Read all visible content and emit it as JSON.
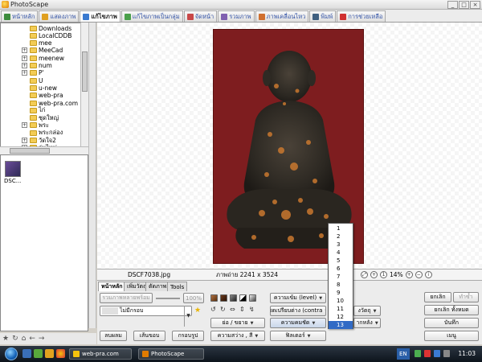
{
  "window": {
    "title": "PhotoScape",
    "min": "_",
    "max": "□",
    "close": "×"
  },
  "tabs": [
    {
      "label": "หน้าหลัก",
      "icon": "home-icon",
      "color": "#3d8c3d"
    },
    {
      "label": "แสดงภาพ",
      "icon": "viewer-icon",
      "color": "#e0a020"
    },
    {
      "label": "แก้ไขภาพ",
      "icon": "editor-icon",
      "color": "#3a7ad0"
    },
    {
      "label": "แก้ไขภาพเป็นกลุ่ม",
      "icon": "batch-icon",
      "color": "#4aa04a"
    },
    {
      "label": "จัดหน้า",
      "icon": "page-icon",
      "color": "#c84848"
    },
    {
      "label": "รวมภาพ",
      "icon": "combine-icon",
      "color": "#8060b0"
    },
    {
      "label": "ภาพเคลื่อนไหว",
      "icon": "gif-icon",
      "color": "#d07030"
    },
    {
      "label": "พิมพ์",
      "icon": "print-icon",
      "color": "#406080"
    },
    {
      "label": "การช่วยเหลือ",
      "icon": "help-icon",
      "color": "#d03030"
    }
  ],
  "tree": {
    "items": [
      {
        "label": "Downloads",
        "plus": false
      },
      {
        "label": "LocalCDDB",
        "plus": false
      },
      {
        "label": "mee",
        "plus": false
      },
      {
        "label": "MeeCad",
        "plus": true
      },
      {
        "label": "meenew",
        "plus": true
      },
      {
        "label": "num",
        "plus": true
      },
      {
        "label": "P'",
        "plus": true
      },
      {
        "label": "U",
        "plus": false
      },
      {
        "label": "u-new",
        "plus": false
      },
      {
        "label": "web-pra",
        "plus": false
      },
      {
        "label": "web-pra.com",
        "plus": false
      },
      {
        "label": "ไก่",
        "plus": false
      },
      {
        "label": "ชุดใหญ่",
        "plus": false
      },
      {
        "label": "พระ",
        "plus": true
      },
      {
        "label": "พระกล่อง",
        "plus": false
      },
      {
        "label": "วัดใจ2",
        "plus": true
      },
      {
        "label": "รุ่นไหม่",
        "plus": true
      }
    ]
  },
  "thumbnail": {
    "label": "DSC..."
  },
  "status": {
    "filename": "DSCF7038.jpg",
    "size": "ภาพถ่าย 2241 x 3524",
    "zoom": "14%"
  },
  "edit_tabs": [
    "หน้าหลัก",
    "เพิ่มวัตถุ",
    "ตัดภาพ",
    "Tools"
  ],
  "controls": {
    "resize_label": "รวมภาพหลายพร้อม",
    "percent": "100%",
    "frame_select": "ไม่มีกรอบ",
    "auto_level": "ความเข้ม (level)",
    "sharpen": "ความคมชัด",
    "brightness": "ความสว่าง , สี",
    "shrink": "ย่อ / ขยาย",
    "backlight": "ชดเปรียบต่าง (contra",
    "filter": "ฟิลเตอร์",
    "save": "ลบผลม",
    "frame_btn": "เส้นขอบ",
    "crop": "กรอบรูป",
    "object_btn": "งวัตถุ",
    "effect_btn": "ากหลัง",
    "undo": "ยกเลิก",
    "redo": "ทำซ้ำ",
    "undo_all": "ยกเลิก ทั้งหมด",
    "save_btn": "บันทึก",
    "menu": "เมนู"
  },
  "dropdown": {
    "items": [
      "1",
      "2",
      "3",
      "4",
      "5",
      "6",
      "7",
      "8",
      "9",
      "10",
      "11",
      "12",
      "13"
    ],
    "selected": "13"
  },
  "taskbar": {
    "app1": "web-pra.com",
    "app2": "PhotoScape",
    "lang": "EN",
    "clock": "11:03"
  }
}
